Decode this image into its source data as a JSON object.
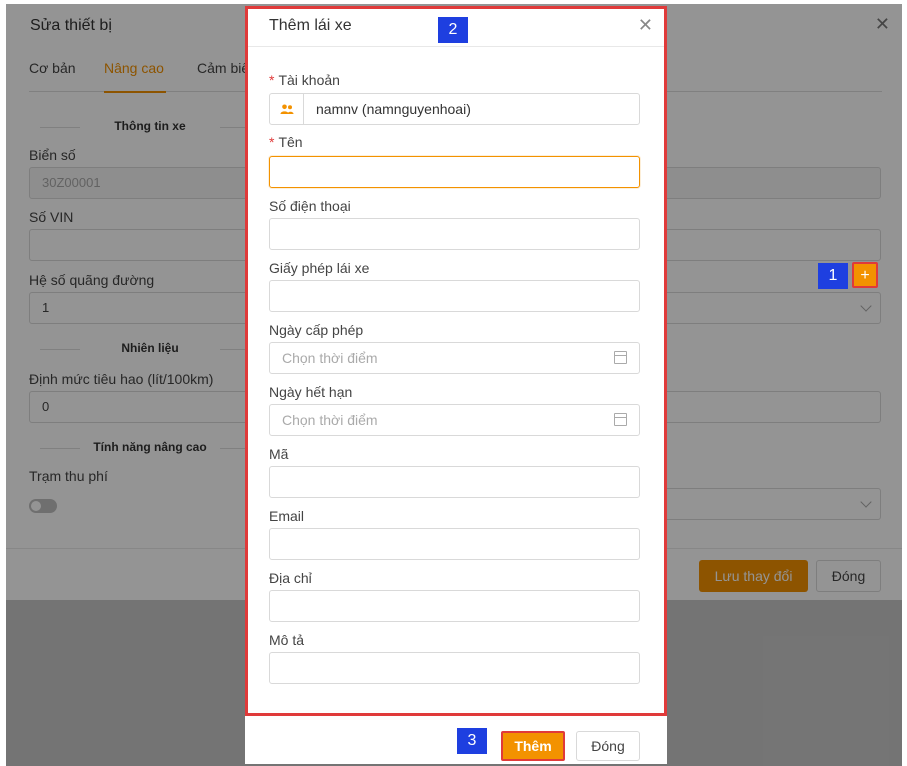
{
  "bg_dialog": {
    "title": "Sửa thiết bị",
    "close_glyph": "✕",
    "tabs": [
      "Cơ bản",
      "Nâng cao",
      "Cảm biế"
    ],
    "active_tab": "Nâng cao",
    "sections": {
      "vehicle_info": "Thông tin xe",
      "fuel": "Nhiên liệu",
      "advanced": "Tính năng nâng cao"
    },
    "fields": {
      "plate_label": "Biển số",
      "plate_value": "30Z00001",
      "vin_label": "Số VIN",
      "vin_value": "",
      "distance_factor_label": "Hệ số quãng đường",
      "distance_factor_value": "1",
      "fuel_norm_label": "Định mức tiêu hao (lít/100km)",
      "fuel_norm_value": "0",
      "toll_label": "Trạm thu phí"
    },
    "plus_glyph": "+",
    "save_button": "Lưu thay đổi",
    "close_button": "Đóng"
  },
  "modal": {
    "title": "Thêm lái xe",
    "close_glyph": "✕",
    "fields": {
      "account_label": "Tài khoản",
      "account_value": "namnv (namnguyenhoai)",
      "name_label": "Tên",
      "phone_label": "Số điện thoại",
      "license_label": "Giấy phép lái xe",
      "issue_date_label": "Ngày cấp phép",
      "issue_date_placeholder": "Chọn thời điểm",
      "expiry_date_label": "Ngày hết hạn",
      "expiry_date_placeholder": "Chọn thời điểm",
      "code_label": "Mã",
      "email_label": "Email",
      "address_label": "Địa chỉ",
      "description_label": "Mô tả"
    },
    "required_mark": "*",
    "add_button": "Thêm",
    "close_button": "Đóng"
  },
  "step_badges": [
    "1",
    "2",
    "3"
  ],
  "colors": {
    "accent": "#f39200",
    "highlight_border": "#e03a3a",
    "badge": "#1e3fe0"
  }
}
